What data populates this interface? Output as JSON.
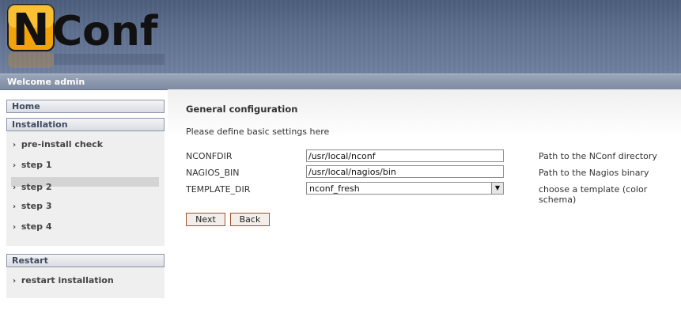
{
  "header": {
    "logo_text_n": "N",
    "logo_text_conf": "Conf",
    "welcome": "Welcome admin"
  },
  "sidebar": {
    "home": "Home",
    "installation": "Installation",
    "install_steps": [
      {
        "label": "pre-install check",
        "active": false
      },
      {
        "label": "step 1",
        "active": false
      },
      {
        "label": "step 2",
        "active": true
      },
      {
        "label": "step 3",
        "active": false
      },
      {
        "label": "step 4",
        "active": false
      }
    ],
    "restart": "Restart",
    "restart_items": [
      {
        "label": "restart installation"
      }
    ]
  },
  "main": {
    "title": "General configuration",
    "description": "Please define basic settings here",
    "rows": [
      {
        "label": "NCONFDIR",
        "value": "/usr/local/nconf",
        "hint": "Path to the NConf directory"
      },
      {
        "label": "NAGIOS_BIN",
        "value": "/usr/local/nagios/bin",
        "hint": "Path to the Nagios binary"
      },
      {
        "label": "TEMPLATE_DIR",
        "value": "nconf_fresh",
        "hint": "choose a template (color schema)"
      }
    ],
    "next_label": "Next",
    "back_label": "Back"
  }
}
